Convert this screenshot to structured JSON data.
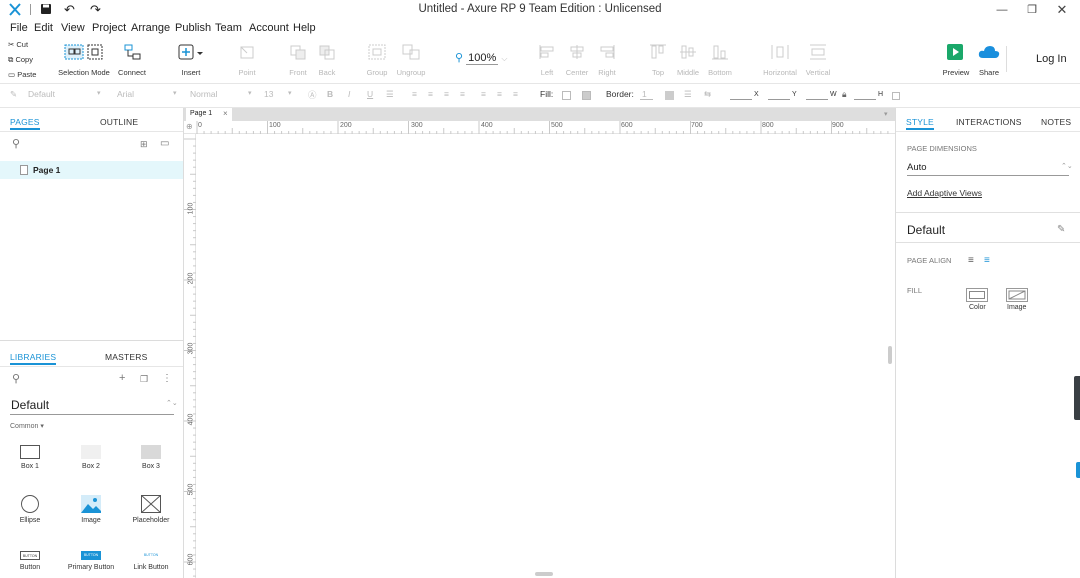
{
  "window": {
    "title": "Untitled - Axure RP 9 Team Edition : Unlicensed"
  },
  "menu": [
    "File",
    "Edit",
    "View",
    "Project",
    "Arrange",
    "Publish",
    "Team",
    "Account",
    "Help"
  ],
  "clipboard": {
    "cut": "Cut",
    "copy": "Copy",
    "paste": "Paste"
  },
  "toolbar": {
    "selection_mode": "Selection Mode",
    "connect": "Connect",
    "insert": "Insert",
    "point": "Point",
    "front": "Front",
    "back": "Back",
    "group": "Group",
    "ungroup": "Ungroup",
    "zoom": "100%",
    "left": "Left",
    "center": "Center",
    "right": "Right",
    "top": "Top",
    "middle": "Middle",
    "bottom": "Bottom",
    "horizontal": "Horizontal",
    "vertical": "Vertical",
    "preview": "Preview",
    "share": "Share",
    "login": "Log In"
  },
  "format": {
    "style": "Default",
    "font": "Arial",
    "weight": "Normal",
    "size": "13",
    "fill": "Fill:",
    "border": "Border:",
    "border_width": "1",
    "x": "X",
    "y": "Y",
    "w": "W",
    "h": "H"
  },
  "left": {
    "pages_tab": "PAGES",
    "outline_tab": "OUTLINE",
    "page1": "Page 1",
    "libraries_tab": "LIBRARIES",
    "masters_tab": "MASTERS",
    "library_name": "Default",
    "common": "Common ▾",
    "widgets": [
      "Box 1",
      "Box 2",
      "Box 3",
      "Ellipse",
      "Image",
      "Placeholder",
      "Button",
      "Primary Button",
      "Link Button"
    ],
    "button_text": "BUTTON"
  },
  "canvas": {
    "tab": "Page 1",
    "hticks": [
      "0",
      "100",
      "200",
      "300",
      "400",
      "500",
      "600",
      "700",
      "800",
      "900"
    ],
    "vticks": [
      "100",
      "200",
      "300",
      "400",
      "500",
      "600"
    ]
  },
  "right": {
    "style_tab": "STYLE",
    "interactions_tab": "INTERACTIONS",
    "notes_tab": "NOTES",
    "page_dimensions": "PAGE DIMENSIONS",
    "dimension_value": "Auto",
    "adaptive": "Add Adaptive Views",
    "default": "Default",
    "page_align": "PAGE ALIGN",
    "fill": "FILL",
    "color": "Color",
    "image": "Image"
  },
  "colors": {
    "accent": "#1a93d6",
    "selected_row": "#e4f7fb",
    "preview_green": "#1aa86a"
  }
}
